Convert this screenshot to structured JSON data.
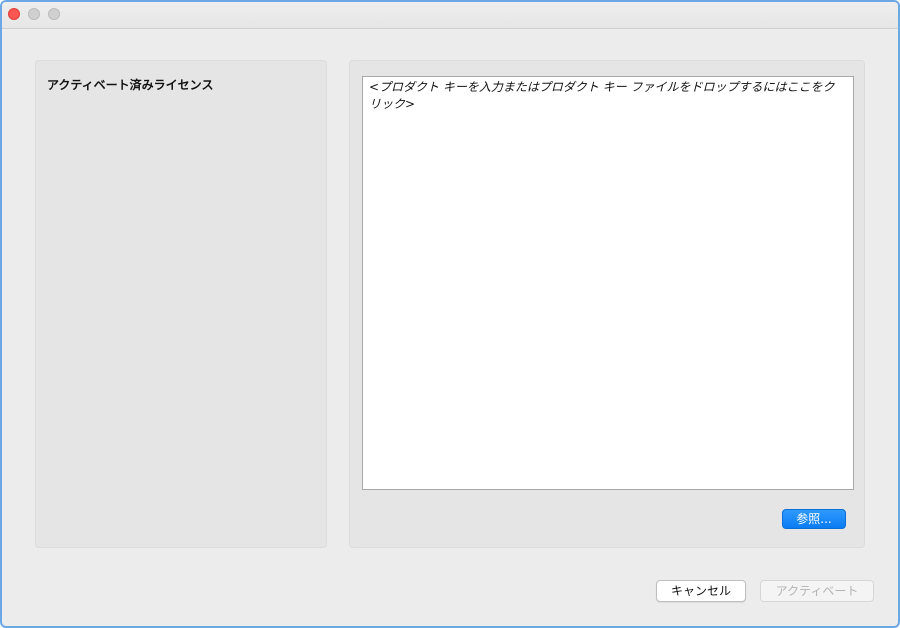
{
  "licenses_panel": {
    "title": "アクティベート済みライセンス"
  },
  "key_input": {
    "placeholder": "<プロダクト キーを入力またはプロダクト キー ファイルをドロップするにはここをクリック>"
  },
  "browse_label": "参照...",
  "footer": {
    "cancel_label": "キャンセル",
    "activate_label": "アクティベート"
  },
  "colors": {
    "accent": "#0a7bf2",
    "close": "#fc5753",
    "window_bg": "#ececec"
  }
}
